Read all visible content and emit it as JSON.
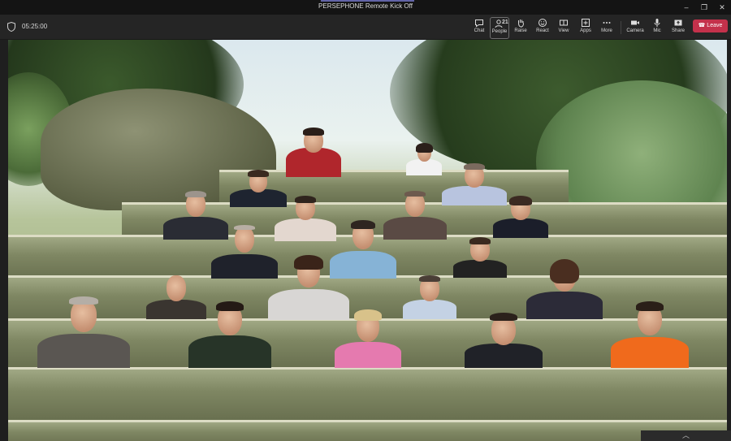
{
  "window": {
    "title": "PERSEPHONE Remote Kick Off",
    "controls": [
      "–",
      "❐",
      "✕"
    ]
  },
  "toolbar": {
    "timer": "05:25:00",
    "buttons": [
      {
        "id": "chat",
        "label": "Chat",
        "icon": "chat-icon"
      },
      {
        "id": "people",
        "label": "People",
        "icon": "people-icon",
        "count": "21"
      },
      {
        "id": "raise",
        "label": "Raise",
        "icon": "hand-icon"
      },
      {
        "id": "react",
        "label": "React",
        "icon": "smiley-icon"
      },
      {
        "id": "view",
        "label": "View",
        "icon": "view-icon"
      },
      {
        "id": "apps",
        "label": "Apps",
        "icon": "apps-icon"
      },
      {
        "id": "more",
        "label": "More",
        "icon": "more-icon"
      },
      {
        "id": "camera",
        "label": "Camera",
        "icon": "camera-icon"
      },
      {
        "id": "mic",
        "label": "Mic",
        "icon": "mic-icon"
      },
      {
        "id": "share",
        "label": "Share",
        "icon": "share-icon"
      }
    ],
    "leave_label": "Leave"
  },
  "colors": {
    "leave": "#c4314b",
    "accent": "#6264a7"
  },
  "collapse_icon": "chevron-up-icon"
}
